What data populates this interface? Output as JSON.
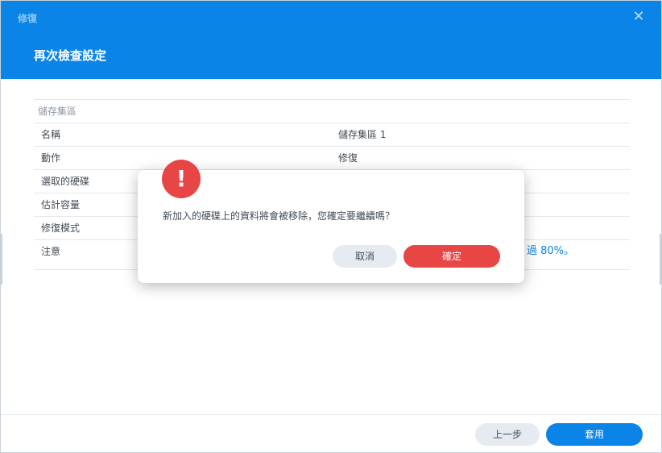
{
  "window": {
    "title": "修復",
    "close_icon": "close-icon",
    "step_title": "再次檢查設定"
  },
  "summary": {
    "section": "儲存集區",
    "rows": [
      {
        "key": "名稱",
        "value": "儲存集區 1"
      },
      {
        "key": "動作",
        "value": "修復"
      },
      {
        "key": "選取的硬碟",
        "value": ""
      },
      {
        "key": "估計容量",
        "value": ""
      },
      {
        "key": "修復模式",
        "value": ""
      },
      {
        "key": "注意",
        "value": "過 80%。"
      }
    ]
  },
  "footer": {
    "prev_label": "上一步",
    "apply_label": "套用"
  },
  "alert": {
    "icon": "exclamation-icon",
    "icon_glyph": "!",
    "message": "新加入的硬碟上的資料將會被移除，您確定要繼續嗎？",
    "cancel_label": "取消",
    "confirm_label": "確定"
  },
  "colors": {
    "accent": "#0a84e6",
    "danger": "#e84545",
    "secondary_button": "#e5ebf0"
  }
}
